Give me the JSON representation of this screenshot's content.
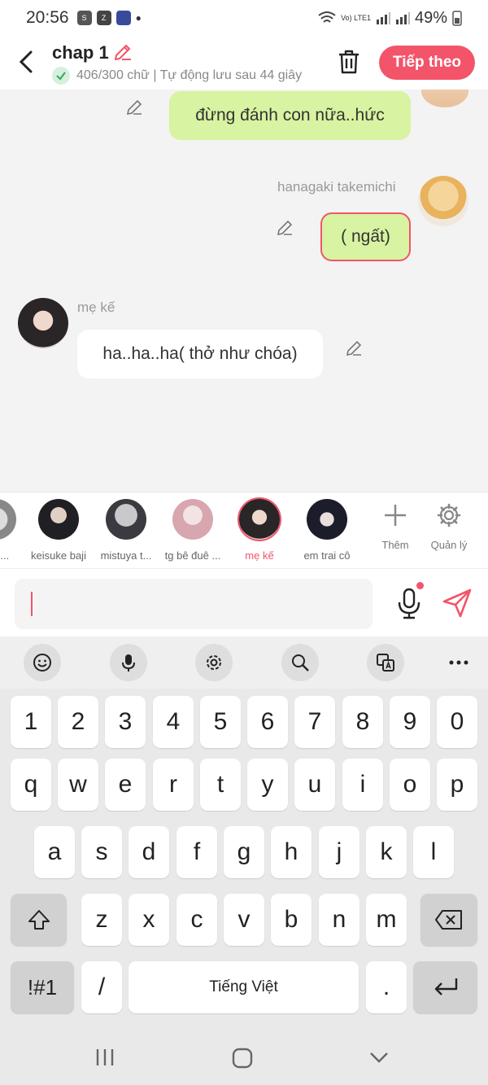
{
  "status": {
    "time": "20:56",
    "battery": "49%",
    "network": "Vo) LTE1"
  },
  "header": {
    "title": "chap 1",
    "subtitle": "406/300 chữ | Tự động lưu sau 44 giây",
    "next_label": "Tiếp theo"
  },
  "messages": [
    {
      "text": "đừng đánh con nữa..hức",
      "side": "right"
    },
    {
      "speaker": "hanagaki takemichi",
      "text": "( ngất)",
      "side": "right"
    },
    {
      "speaker": "mẹ kế",
      "text": "ha..ha..ha( thở như chóa)",
      "side": "left"
    }
  ],
  "characters": [
    {
      "name": "...o ..."
    },
    {
      "name": "keisuke baji"
    },
    {
      "name": "mistuya t..."
    },
    {
      "name": "tg bê đuê ..."
    },
    {
      "name": "mẹ kế",
      "selected": true
    },
    {
      "name": "em trai cô"
    }
  ],
  "tools": {
    "add_label": "Thêm",
    "manage_label": "Quản lý"
  },
  "keyboard": {
    "numbers": [
      "1",
      "2",
      "3",
      "4",
      "5",
      "6",
      "7",
      "8",
      "9",
      "0"
    ],
    "row1": [
      "q",
      "w",
      "e",
      "r",
      "t",
      "y",
      "u",
      "i",
      "o",
      "p"
    ],
    "row2": [
      "a",
      "s",
      "d",
      "f",
      "g",
      "h",
      "j",
      "k",
      "l"
    ],
    "row3": [
      "z",
      "x",
      "c",
      "v",
      "b",
      "n",
      "m"
    ],
    "symbols_label": "!#1",
    "slash": "/",
    "space_label": "Tiếng Việt",
    "period": "."
  },
  "colors": {
    "accent": "#f3546a",
    "my_bubble": "#d8f3a1"
  }
}
